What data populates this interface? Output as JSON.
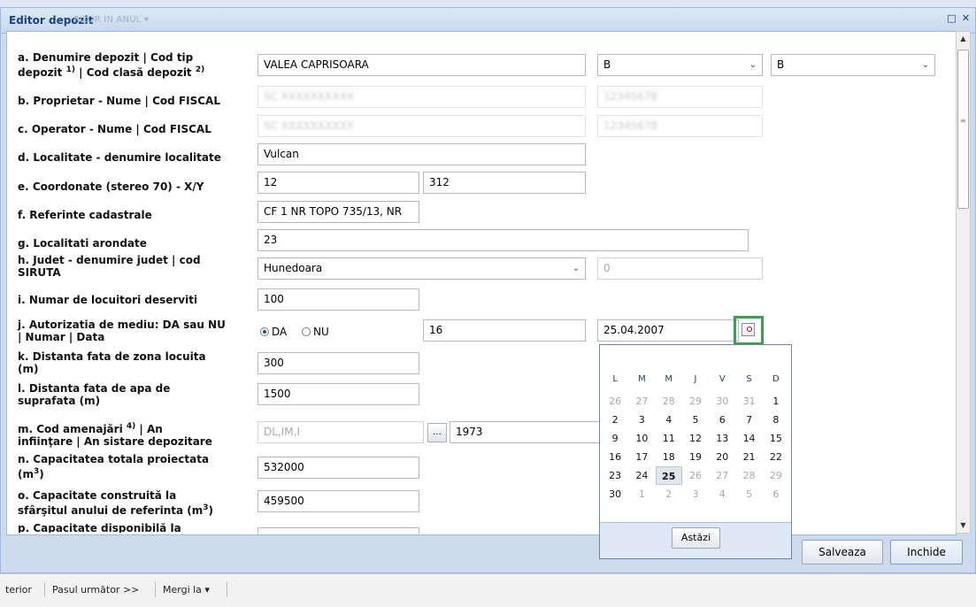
{
  "background_title": "RILOR IN ANUL ▾",
  "window": {
    "title": "Editor depozit",
    "tool_restore": "□",
    "tool_close": "✕"
  },
  "labels": {
    "a_line1": "a. Denumire depozit | Cod tip",
    "a_line2_pre": "depozit ",
    "a_sup1": "1)",
    "a_line2_mid": " | Cod clasă depozit ",
    "a_sup2": "2)",
    "b": "b. Proprietar - Nume | Cod FISCAL",
    "c": "c. Operator - Nume | Cod FISCAL",
    "d": "d. Localitate - denumire localitate",
    "e": "e. Coordonate (stereo 70) - X/Y",
    "f": "f. Referinte cadastrale",
    "g": "g. Localitati arondate",
    "h_line1": "h. Judet - denumire judet | cod",
    "h_line2": "SIRUTA",
    "i": "i. Numar de locuitori deserviti",
    "j_line1": "j. Autorizatia de mediu: DA sau NU",
    "j_line2": "| Numar | Data",
    "k_line1": "k. Distanta fata de zona locuita",
    "k_line2": "(m)",
    "l_line1": "l. Distanta fata de apa de",
    "l_line2": "suprafata (m)",
    "m_line1_pre": "m. Cod amenajări ",
    "m_sup": "4)",
    "m_line1_post": " | An",
    "m_line2": "infiinţare | An sistare depozitare",
    "n_line1": "n. Capacitatea totala proiectata",
    "n_line2_pre": "(m",
    "n_sup": "3",
    "n_line2_post": ")",
    "o_line1": "o. Capacitate construită la",
    "o_line2_pre": "sfârşitul anului de referinta (m",
    "o_sup": "3",
    "o_line2_post": ")",
    "p_line1": "p. Capacitate disponibilă la"
  },
  "values": {
    "denumire": "VALEA CAPRISOARA",
    "cod_tip": "B",
    "cod_clasa": "B",
    "proprietar_nume": "SC XXXXXXXXXX",
    "proprietar_cod": "12345678",
    "operator_nume": "SC XXXXXXXXXX",
    "operator_cod": "12345678",
    "localitate": "Vulcan",
    "coord_x": "12",
    "coord_y": "312",
    "referinte": "CF 1 NR TOPO 735/13, NR",
    "arondate": "23",
    "judet": "Hunedoara",
    "siruta": "0",
    "locuitori": "100",
    "radio_da": "DA",
    "radio_nu": "NU",
    "aut_numar": "16",
    "aut_data": "25.04.2007",
    "dist_zona": "300",
    "dist_apa": "1500",
    "cod_amenajari": "DL,IM,I",
    "amenajari_btn": "...",
    "an_infiintare": "1973",
    "cap_totala": "532000",
    "cap_construita": "459500"
  },
  "datepicker": {
    "weekdays": [
      "L",
      "M",
      "M",
      "J",
      "V",
      "S",
      "D"
    ],
    "rows": [
      [
        "26",
        "27",
        "28",
        "29",
        "30",
        "31",
        "1"
      ],
      [
        "2",
        "3",
        "4",
        "5",
        "6",
        "7",
        "8"
      ],
      [
        "9",
        "10",
        "11",
        "12",
        "13",
        "14",
        "15"
      ],
      [
        "16",
        "17",
        "18",
        "19",
        "20",
        "21",
        "22"
      ],
      [
        "23",
        "24",
        "25",
        "26",
        "27",
        "28",
        "29"
      ],
      [
        "30",
        "1",
        "2",
        "3",
        "4",
        "5",
        "6"
      ]
    ],
    "selected_day": "25",
    "today_label": "Astăzi"
  },
  "buttons": {
    "save": "Salveaza",
    "close": "Inchide"
  },
  "bottom_bar": {
    "prev": "terior",
    "next": "Pasul următor >>",
    "goto": "Mergi la ▾"
  }
}
